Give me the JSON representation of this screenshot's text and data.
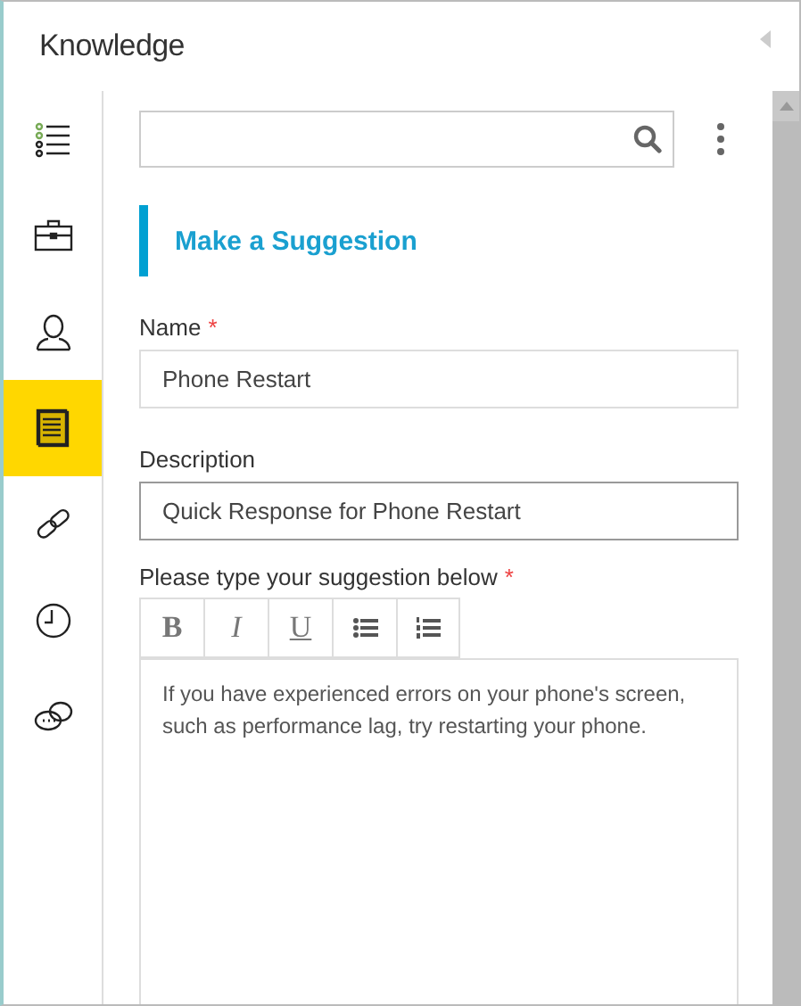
{
  "panel": {
    "title": "Knowledge"
  },
  "sidebar": {
    "items": [
      {
        "kind": "list",
        "selected": false
      },
      {
        "kind": "briefcase",
        "selected": false
      },
      {
        "kind": "person",
        "selected": false
      },
      {
        "kind": "document",
        "selected": true
      },
      {
        "kind": "link",
        "selected": false
      },
      {
        "kind": "clock",
        "selected": false
      },
      {
        "kind": "chat",
        "selected": false
      }
    ]
  },
  "search": {
    "kind": "search"
  },
  "heading": "Make a Suggestion",
  "fields": [
    {
      "label": "Name",
      "required_mark": "*",
      "value": "Phone Restart",
      "focused": false
    },
    {
      "label": "Description",
      "value": "Quick Response for Phone Restart",
      "focused": true
    }
  ],
  "suggestion": {
    "label": "Please type your suggestion below",
    "required_mark": "*",
    "toolbar": [
      {
        "kind": "bold",
        "label": "B"
      },
      {
        "kind": "italic",
        "label": "I"
      },
      {
        "kind": "underline",
        "label": "U"
      },
      {
        "kind": "bullets"
      },
      {
        "kind": "numbers"
      }
    ],
    "value": "If you have experienced errors on your phone's screen, such as performance lag, try restarting your phone."
  }
}
